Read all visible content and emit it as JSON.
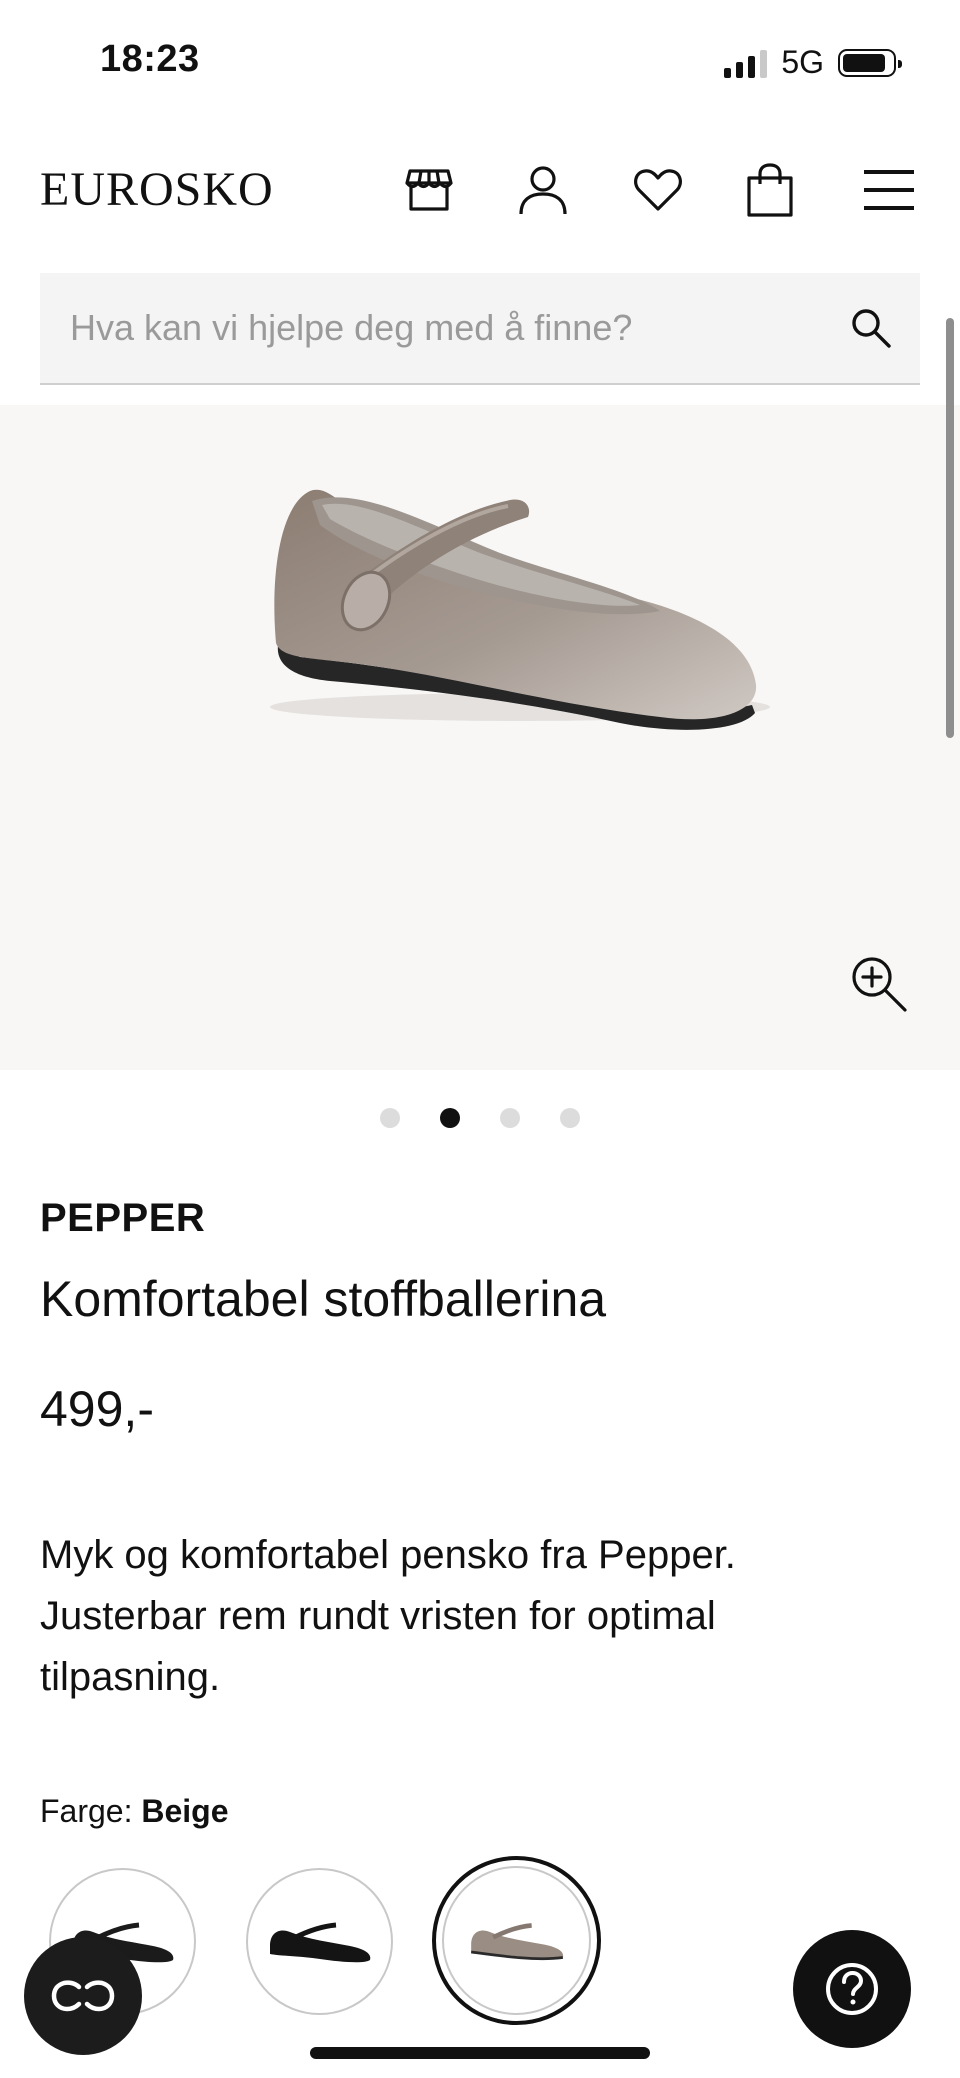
{
  "status_bar": {
    "time": "18:23",
    "network": "5G"
  },
  "header": {
    "logo": "EUROSKO",
    "icons": [
      "store-icon",
      "account-icon",
      "heart-icon",
      "bag-icon",
      "menu-icon"
    ]
  },
  "search": {
    "placeholder": "Hva kan vi hjelpe deg med å finne?",
    "value": ""
  },
  "gallery": {
    "image_count": 4,
    "active_index": 2
  },
  "product": {
    "brand": "PEPPER",
    "name": "Komfortabel stoffballerina",
    "price": "499,-",
    "description": "Myk og komfortabel pensko fra Pepper. Justerbar rem rundt vristen for optimal tilpasning."
  },
  "color": {
    "label": "Farge:",
    "selected": "Beige",
    "swatches": [
      {
        "color": "#1b1b1b",
        "selected": false
      },
      {
        "color": "#141414",
        "selected": false
      },
      {
        "color": "#9a8d84",
        "selected": true
      }
    ]
  },
  "colors": {
    "text": "#111111",
    "search_bg": "#f4f4f4",
    "gallery_bg": "#f8f7f6",
    "fab_bg": "#1c1c1c"
  }
}
